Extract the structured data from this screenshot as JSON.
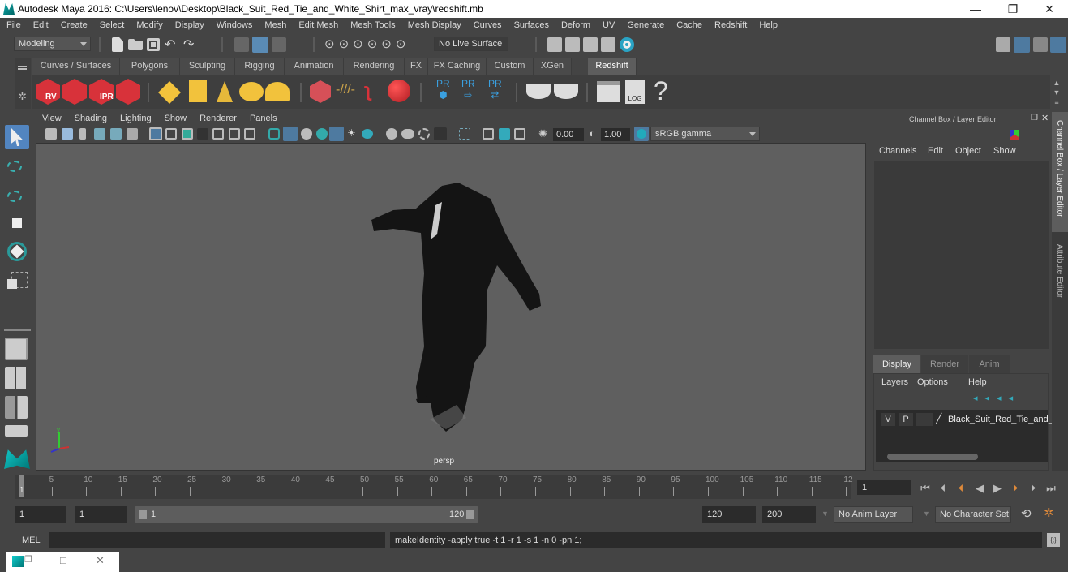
{
  "window": {
    "title": "Autodesk Maya 2016: C:\\Users\\lenov\\Desktop\\Black_Suit_Red_Tie_and_White_Shirt_max_vray\\redshift.mb",
    "minimize": "—",
    "restore": "❐",
    "close": "✕"
  },
  "menubar": [
    "File",
    "Edit",
    "Create",
    "Select",
    "Modify",
    "Display",
    "Windows",
    "Mesh",
    "Edit Mesh",
    "Mesh Tools",
    "Mesh Display",
    "Curves",
    "Surfaces",
    "Deform",
    "UV",
    "Generate",
    "Cache",
    "Redshift",
    "Help"
  ],
  "statusline": {
    "mode": "Modeling",
    "live_surface": "No Live Surface"
  },
  "shelf": {
    "tabs": [
      "Curves / Surfaces",
      "Polygons",
      "Sculpting",
      "Rigging",
      "Animation",
      "Rendering",
      "FX",
      "FX Caching",
      "Custom",
      "XGen",
      "Redshift"
    ],
    "active_tab": "Redshift",
    "icon_labels": {
      "rv": "RV",
      "ipr": "IPR",
      "pr1": "PR",
      "pr2": "PR",
      "pr3": "PR",
      "log": "LOG",
      "help": "?"
    }
  },
  "viewport": {
    "menus": [
      "View",
      "Shading",
      "Lighting",
      "Show",
      "Renderer",
      "Panels"
    ],
    "exposure": "0.00",
    "gamma": "1.00",
    "color_space": "sRGB gamma",
    "camera_label": "persp",
    "axis": {
      "y": "y",
      "x": "x",
      "z": "z"
    }
  },
  "channel_box": {
    "title": "Channel Box / Layer Editor",
    "menus": [
      "Channels",
      "Edit",
      "Object",
      "Show"
    ],
    "layer_tabs": [
      "Display",
      "Render",
      "Anim"
    ],
    "active_layer_tab": "Display",
    "layer_menus": [
      "Layers",
      "Options",
      "Help"
    ],
    "layer": {
      "v": "V",
      "p": "P",
      "name": "Black_Suit_Red_Tie_and_"
    }
  },
  "side_tabs": [
    "Channel Box / Layer Editor",
    "Attribute Editor"
  ],
  "timeline": {
    "ticks": [
      "5",
      "10",
      "15",
      "20",
      "25",
      "30",
      "35",
      "40",
      "45",
      "50",
      "55",
      "60",
      "65",
      "70",
      "75",
      "80",
      "85",
      "90",
      "95",
      "100",
      "105",
      "110",
      "115",
      "12"
    ],
    "current_frame_marker": "1",
    "current_frame": "1"
  },
  "range": {
    "start": "1",
    "playback_start": "1",
    "slider_start": "1",
    "slider_end": "120",
    "playback_end": "120",
    "end": "200",
    "anim_layer": "No Anim Layer",
    "character_set": "No Character Set"
  },
  "command": {
    "lang": "MEL",
    "input": "",
    "result": "makeIdentity -apply true -t 1 -r 1 -s 1 -n 0 -pn 1;"
  }
}
